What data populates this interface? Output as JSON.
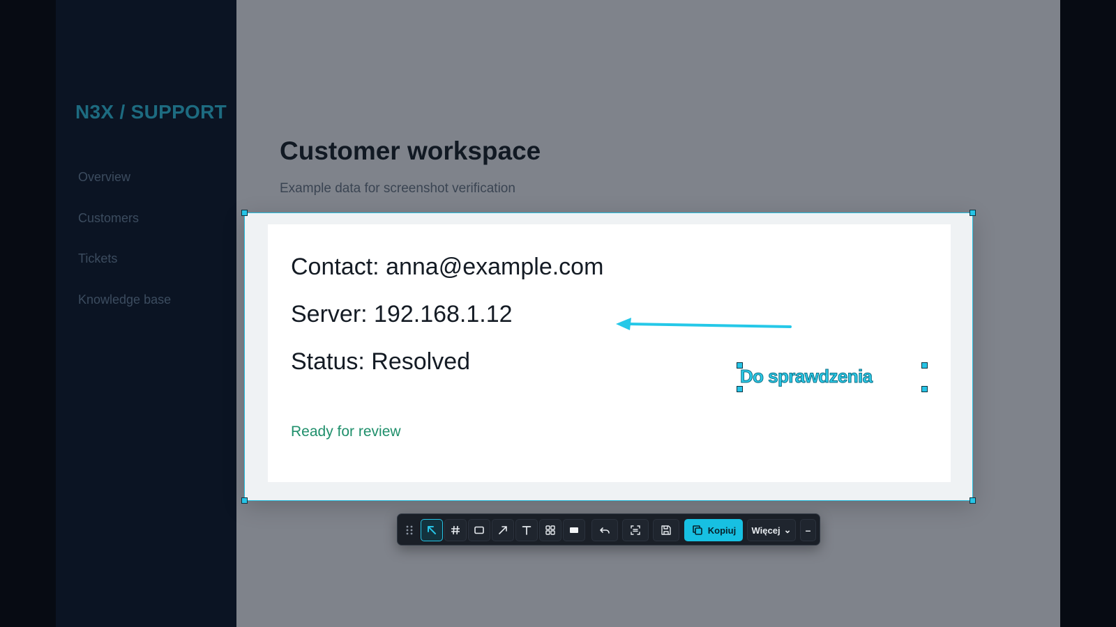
{
  "sidebar": {
    "brand": "N3X / SUPPORT",
    "nav": [
      "Overview",
      "Customers",
      "Tickets",
      "Knowledge base"
    ]
  },
  "page": {
    "title": "Customer workspace",
    "subtitle": "Example data for screenshot verification"
  },
  "card": {
    "contact": "Contact: anna@example.com",
    "server": "Server: 192.168.1.12",
    "status": "Status: Resolved",
    "review": "Ready for review"
  },
  "annotation": {
    "text": "Do sprawdzenia",
    "arrow_icon": "arrow-left-icon"
  },
  "toolbar": {
    "tools": [
      "select-tool",
      "grid-tool",
      "rectangle-tool",
      "arrow-tool",
      "text-tool",
      "blur-tool",
      "redact-tool"
    ],
    "copy_label": "Kopiuj",
    "more_label": "Więcej",
    "more_chevron": "⌄",
    "minimize_label": "–"
  },
  "colors": {
    "accent": "#27c4e6",
    "brand": "#1d6b80",
    "success": "#1f8f6b",
    "sidebar_bg": "#0b1423",
    "overlay_bg": "#7f838b"
  }
}
